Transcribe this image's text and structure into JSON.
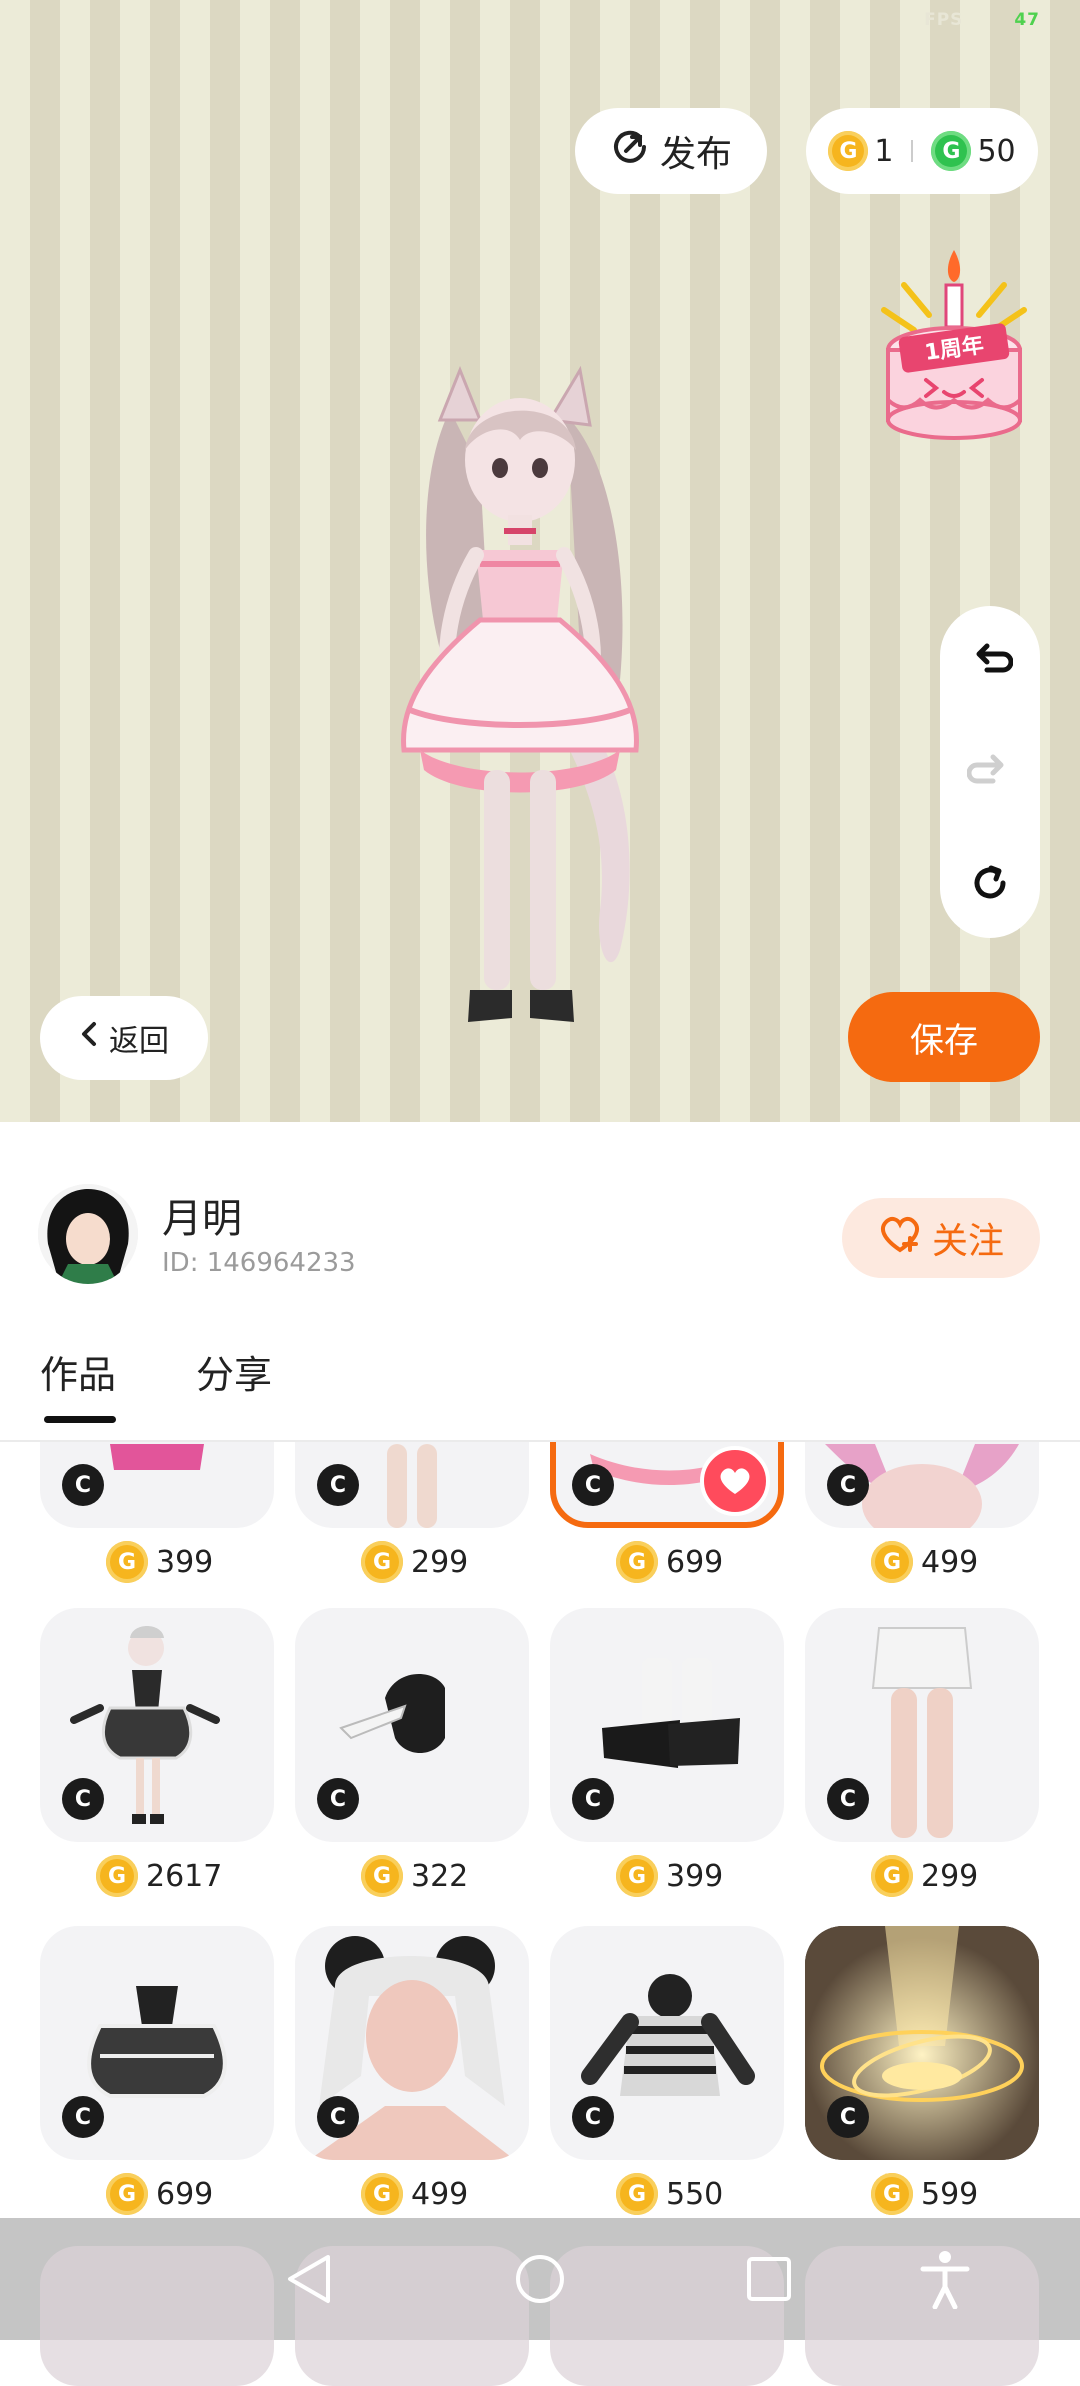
{
  "status": {
    "fps_label": "FPS",
    "fps_value": "47"
  },
  "header": {
    "publish_label": "发布",
    "currency": {
      "gold_symbol": "G",
      "gold_count": "1",
      "green_symbol": "G",
      "green_count": "50"
    }
  },
  "event_badge": {
    "text": "1周年"
  },
  "controls": {
    "back_label": "返回",
    "save_label": "保存"
  },
  "profile": {
    "name": "月明",
    "id": "ID: 146964233",
    "follow_label": "关注"
  },
  "tabs": [
    {
      "label": "作品",
      "active": true
    },
    {
      "label": "分享",
      "active": false
    }
  ],
  "items": [
    {
      "name": "pink-skirt",
      "price": "399",
      "badge": "C"
    },
    {
      "name": "legs",
      "price": "299",
      "badge": "C"
    },
    {
      "name": "pink-dress-selected",
      "price": "699",
      "badge": "C",
      "selected": true,
      "favorited": true
    },
    {
      "name": "pink-hair",
      "price": "499",
      "badge": "C"
    },
    {
      "name": "black-white-outfit",
      "price": "2617",
      "badge": "C"
    },
    {
      "name": "black-cap",
      "price": "322",
      "badge": "C"
    },
    {
      "name": "black-shoes",
      "price": "399",
      "badge": "C"
    },
    {
      "name": "white-shorts",
      "price": "299",
      "badge": "C"
    },
    {
      "name": "black-dress",
      "price": "699",
      "badge": "C"
    },
    {
      "name": "panda-hair",
      "price": "499",
      "badge": "C"
    },
    {
      "name": "striped-hoodie",
      "price": "550",
      "badge": "C"
    },
    {
      "name": "golden-halo-effect",
      "price": "599",
      "badge": "C"
    }
  ],
  "colors": {
    "accent": "#f56a10",
    "coin_gold": "#f6b51e",
    "coin_green": "#2fc24f",
    "heart": "#ff4b5c"
  }
}
